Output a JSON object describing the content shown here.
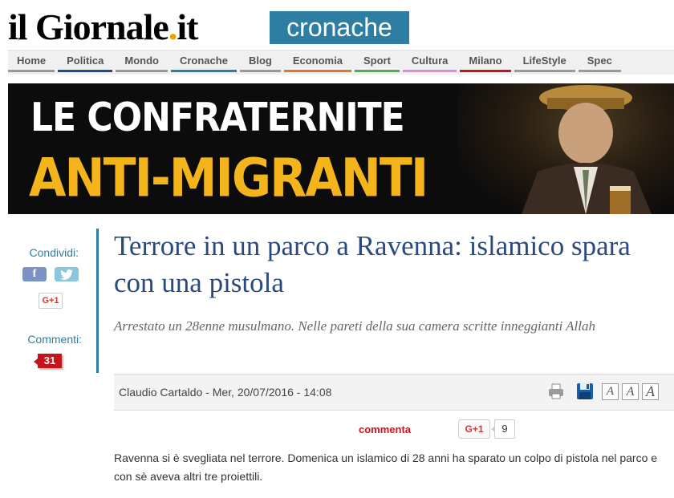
{
  "header": {
    "logo_main": "il Giornale",
    "logo_dot": ".",
    "logo_tld": "it",
    "section": "cronache"
  },
  "nav": {
    "items": [
      {
        "label": "Home",
        "color": "#9a9a9a"
      },
      {
        "label": "Politica",
        "color": "#1f4e8c"
      },
      {
        "label": "Mondo",
        "color": "#9a9a9a"
      },
      {
        "label": "Cronache",
        "color": "#2e7da3"
      },
      {
        "label": "Blog",
        "color": "#9a9a9a"
      },
      {
        "label": "Economia",
        "color": "#e0762b"
      },
      {
        "label": "Sport",
        "color": "#4caf50"
      },
      {
        "label": "Cultura",
        "color": "#e08ad3"
      },
      {
        "label": "Milano",
        "color": "#c4151c"
      },
      {
        "label": "LifeStyle",
        "color": "#9a9a9a"
      },
      {
        "label": "Spec",
        "color": "#9a9a9a"
      }
    ]
  },
  "banner": {
    "line1": "LE CONFRATERNITE",
    "line2": "ANTI-MIGRANTI"
  },
  "sidebar": {
    "share_label": "Condividi:",
    "facebook": "f",
    "gplus": "G+1",
    "comments_label": "Commenti:",
    "comments_count": "31"
  },
  "article": {
    "title": "Terrore in un parco a Ravenna: islamico spara con una pistola",
    "subtitle": "Arrestato un 28enne musulmano. Nelle pareti della sua camera scritte inneggianti Allah",
    "byline": "Claudio Cartaldo - Mer, 20/07/2016 - 14:08",
    "font_buttons": [
      "A",
      "A",
      "A"
    ],
    "commenta": "commenta",
    "gplus_label": "G+1",
    "gplus_count": "9",
    "body": "Ravenna si è svegliata nel terrore. Domenica un islamico di 28 anni ha sparato un colpo di pistola nel parco e con sè aveva altri tre proiettili."
  },
  "colors": {
    "brand_blue": "#2e7da3",
    "title_blue": "#2a4a7f",
    "banner_yellow": "#f3b51b",
    "comment_red": "#c4151c"
  }
}
